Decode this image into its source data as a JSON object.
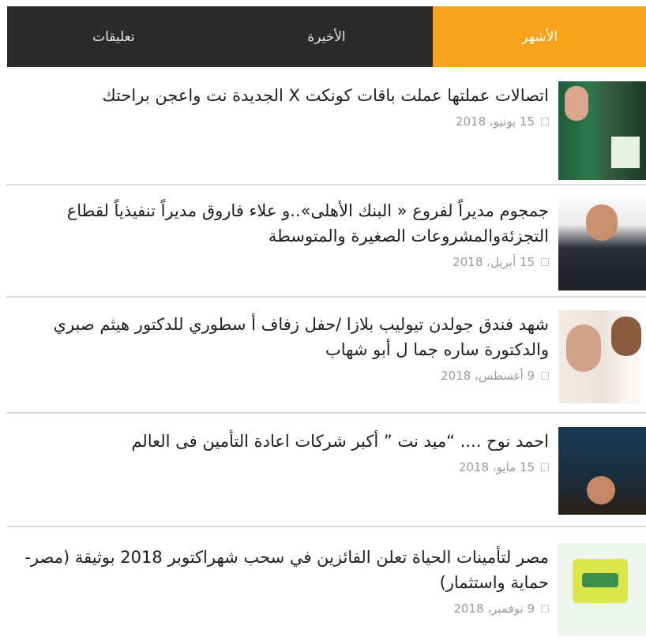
{
  "tabs": [
    {
      "label": "الأشهر",
      "active": true
    },
    {
      "label": "الأخيرة",
      "active": false
    },
    {
      "label": "تعليقات",
      "active": false
    }
  ],
  "colors": {
    "tab_bar": "#2b2b2b",
    "tab_active": "#f7a31a",
    "title": "#1e1e1e",
    "date": "#9a9a9a"
  },
  "posts": [
    {
      "title": "اتصالات عملتها عملت باقات كونكت X الجديدة نت واعجن براحتك",
      "date": "15 يونيو، 2018"
    },
    {
      "title": "جمجوم مديراً لفروع « البنك الأهلى»..و علاء فاروق مديراً تنفيذياً لقطاع التجزئةوالمشروعات الصغيرة والمتوسطة",
      "date": "15 أبريل، 2018"
    },
    {
      "title": "شهد فندق جولدن تيوليب بلازا /حفل زفاف أ سطوري للدكتور هيثم صبري والدكتورة ساره جما ل أبو شهاب",
      "date": "9 أغسطس، 2018"
    },
    {
      "title": "احمد نوح .... “ميد نت ” أكبر شركات اعادة التأمين فى العالم",
      "date": "15 مايو، 2018"
    },
    {
      "title": "مصر لتأمينات الحياة تعلن الفائزين في سحب شهراكتوبر 2018 بوثيقة (مصر- حماية واستثمار)",
      "date": "9 نوفمبر، 2018"
    }
  ]
}
